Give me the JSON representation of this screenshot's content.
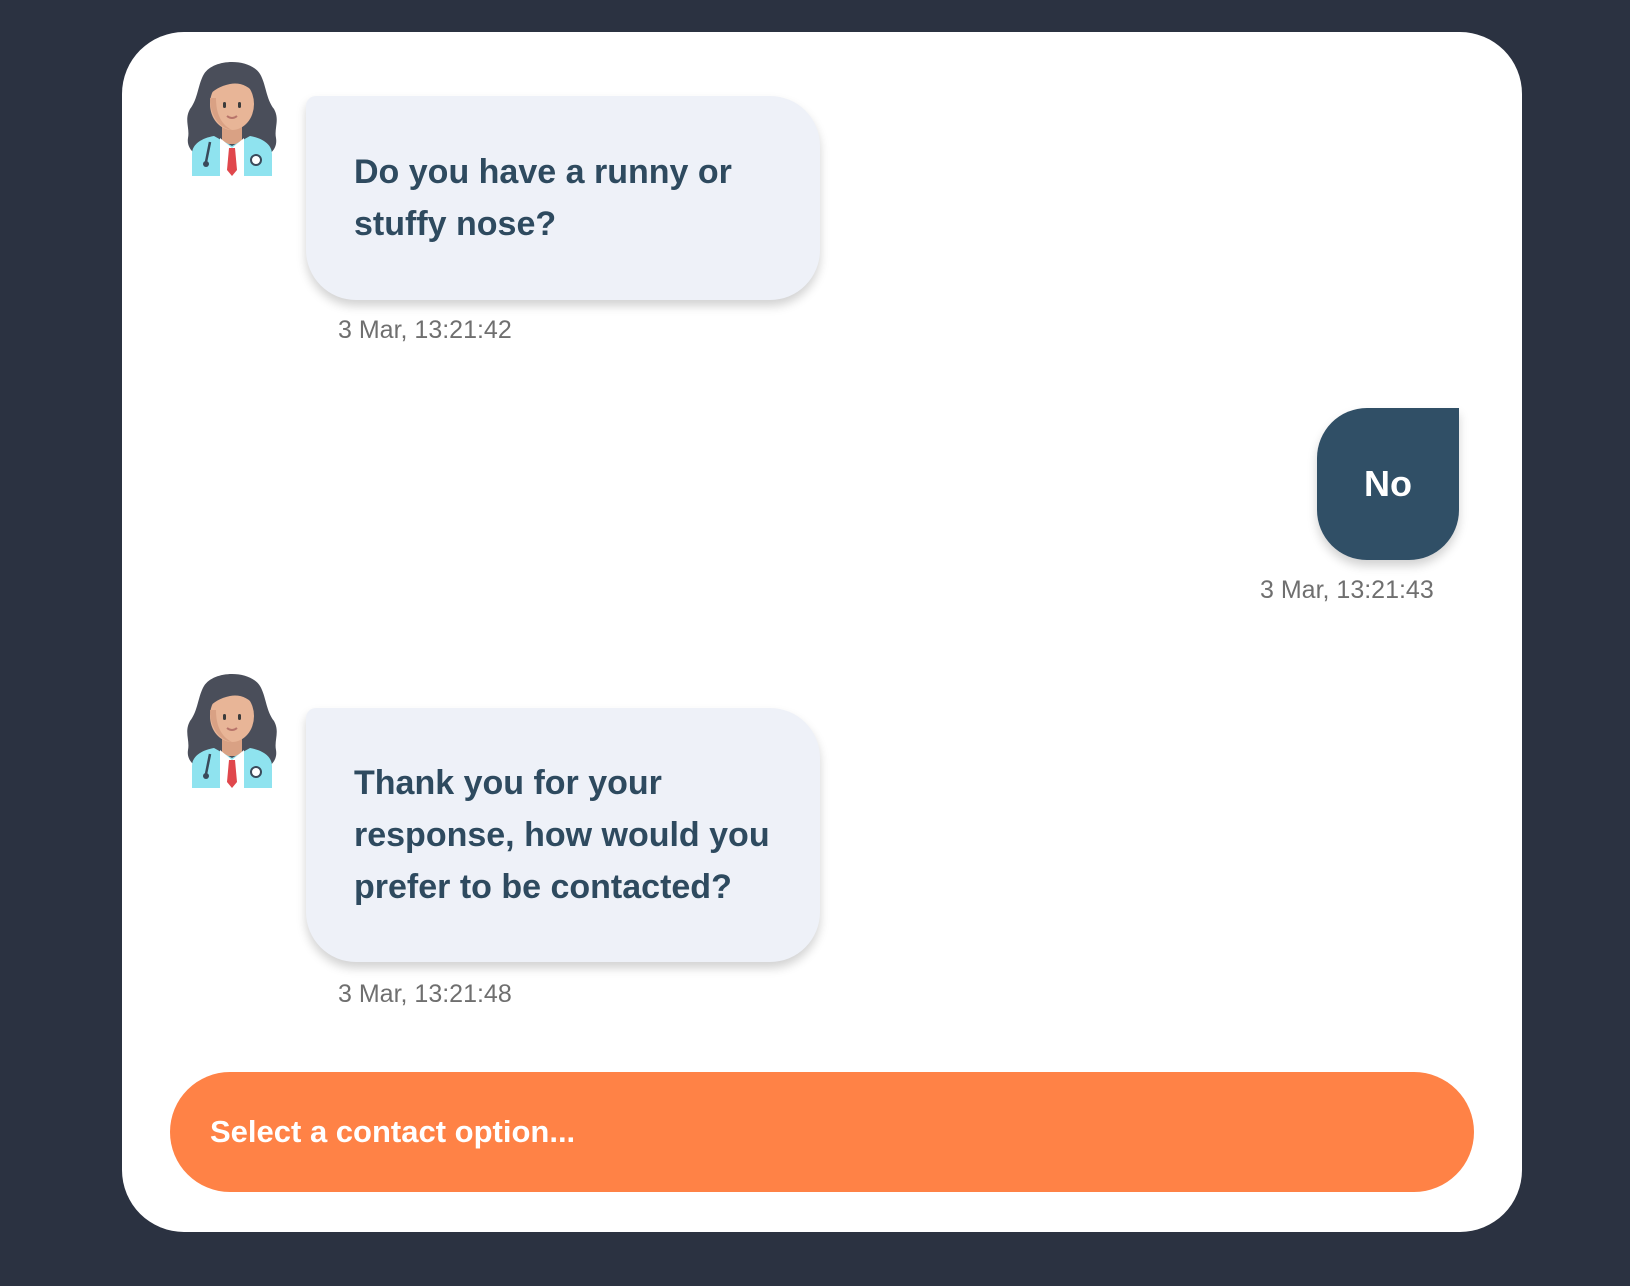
{
  "messages": [
    {
      "sender": "bot",
      "text": "Do you have a runny or stuffy nose?",
      "time": "3 Mar, 13:21:42",
      "avatar_icon": "doctor-avatar-icon"
    },
    {
      "sender": "user",
      "text": "No",
      "time": "3 Mar, 13:21:43"
    },
    {
      "sender": "bot",
      "text": "Thank you for your response, how would you prefer to be contacted?",
      "time": "3 Mar, 13:21:48",
      "avatar_icon": "doctor-avatar-icon"
    }
  ],
  "contact_select": {
    "placeholder": "Select a contact option..."
  },
  "colors": {
    "page_background": "#2b3241",
    "card_background": "#ffffff",
    "bot_bubble": "#eef1f8",
    "bot_text": "#2e4a5f",
    "user_bubble": "#304f66",
    "user_text": "#ffffff",
    "timestamp": "#6f6f6f",
    "accent": "#ff8246"
  }
}
